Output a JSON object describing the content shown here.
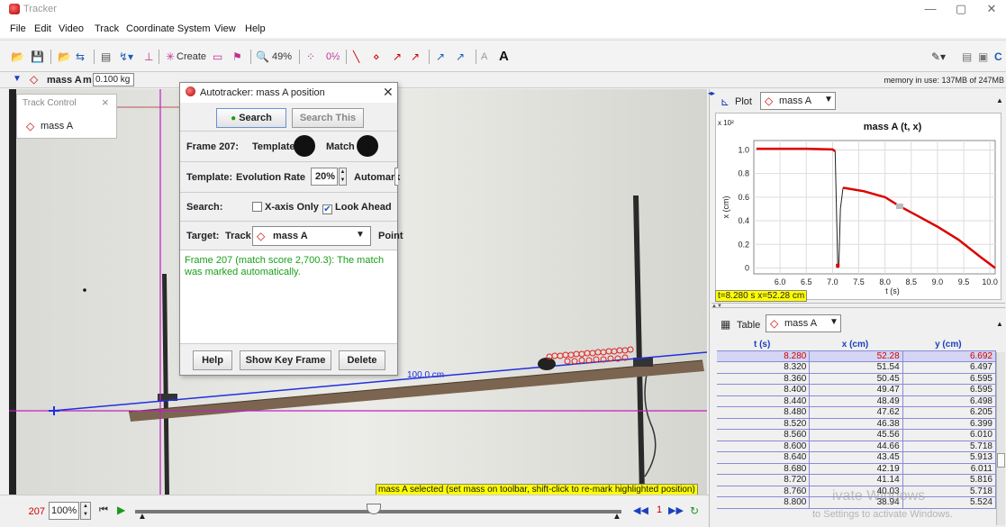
{
  "window": {
    "title": "Tracker",
    "controls": [
      "—",
      "▢",
      "✕"
    ]
  },
  "menu": [
    "File",
    "Edit",
    "Video",
    "Track",
    "Coordinate System",
    "View",
    "Help"
  ],
  "toolbar": {
    "create_label": "Create",
    "zoom_label": "49%",
    "memory": "memory in use: 137MB of 247MB"
  },
  "trackbar": {
    "track_name": "mass A",
    "mass_label": "m",
    "mass_value": "0.100 kg"
  },
  "track_control": {
    "title": "Track Control",
    "item": "mass A"
  },
  "autotracker": {
    "title": "Autotracker: mass A position",
    "search_button": "Search",
    "search_this_button": "Search This",
    "frame_label": "Frame 207:",
    "template_label": "Template",
    "match_label": "Match",
    "template_row_label": "Template:",
    "evolution_label": "Evolution Rate",
    "evolution_value": "20%",
    "automark_label": "Automark",
    "search_row_label": "Search:",
    "xaxis_label": "X-axis Only",
    "lookahead_label": "Look Ahead",
    "target_label": "Target:",
    "track_label": "Track",
    "target_track": "mass A",
    "point_label": "Point",
    "message": "Frame 207 (match score 2,700.3): The match was marked automatically.",
    "help_button": "Help",
    "keyframe_button": "Show Key Frame",
    "delete_button": "Delete"
  },
  "video": {
    "tape_label": "100.0 cm",
    "status_message": "mass A selected (set mass on toolbar, shift-click to re-mark highlighted position)"
  },
  "player": {
    "frame": "207",
    "zoom": "100%",
    "step": "1",
    "slider_fraction": 0.49
  },
  "plot": {
    "tab_label": "Plot",
    "track": "mass A",
    "readout": "t=8.280 s  x=52.28 cm"
  },
  "chart_data": {
    "type": "line",
    "title": "mass A (t, x)",
    "xlabel": "t (s)",
    "ylabel": "x (cm)",
    "y_multiplier": "x 10²",
    "xlim": [
      5.5,
      10.1
    ],
    "ylim": [
      -0.05,
      1.08
    ],
    "xticks": [
      "6.0",
      "6.5",
      "7.0",
      "7.5",
      "8.0",
      "8.5",
      "9.0",
      "9.5",
      "10.0"
    ],
    "yticks": [
      "0",
      "0.2",
      "0.4",
      "0.6",
      "0.8",
      "1.0"
    ],
    "segments": [
      {
        "x": [
          5.55,
          6.5,
          7.0,
          7.05
        ],
        "y": [
          1.01,
          1.01,
          1.005,
          0.99
        ]
      },
      {
        "x": [
          7.05,
          7.1,
          7.12
        ],
        "y": [
          0.99,
          0.0,
          0.02
        ]
      },
      {
        "x": [
          7.12,
          7.15,
          7.2
        ],
        "y": [
          0.02,
          0.5,
          0.68
        ]
      },
      {
        "x": [
          7.2,
          7.6,
          8.0,
          8.28,
          8.6,
          9.0,
          9.4,
          9.8,
          10.1
        ],
        "y": [
          0.68,
          0.65,
          0.6,
          0.5228,
          0.4466,
          0.35,
          0.24,
          0.1,
          0.0
        ]
      }
    ],
    "highlight": {
      "x": 8.28,
      "y": 0.5228
    },
    "grid": true
  },
  "table": {
    "tab_label": "Table",
    "track": "mass A",
    "headers": [
      "t (s)",
      "x (cm)",
      "y (cm)"
    ],
    "rows": [
      [
        "8.280",
        "52.28",
        "6.692"
      ],
      [
        "8.320",
        "51.54",
        "6.497"
      ],
      [
        "8.360",
        "50.45",
        "6.595"
      ],
      [
        "8.400",
        "49.47",
        "6.595"
      ],
      [
        "8.440",
        "48.49",
        "6.498"
      ],
      [
        "8.480",
        "47.62",
        "6.205"
      ],
      [
        "8.520",
        "46.38",
        "6.399"
      ],
      [
        "8.560",
        "45.56",
        "6.010"
      ],
      [
        "8.600",
        "44.66",
        "5.718"
      ],
      [
        "8.640",
        "43.45",
        "5.913"
      ],
      [
        "8.680",
        "42.19",
        "6.011"
      ],
      [
        "8.720",
        "41.14",
        "5.816"
      ],
      [
        "8.760",
        "40.03",
        "5.718"
      ],
      [
        "8.800",
        "38.94",
        "5.524"
      ]
    ],
    "selected_row": 0
  },
  "watermark": {
    "line1": "ivate Windows",
    "line2": "to Settings to activate Windows."
  }
}
